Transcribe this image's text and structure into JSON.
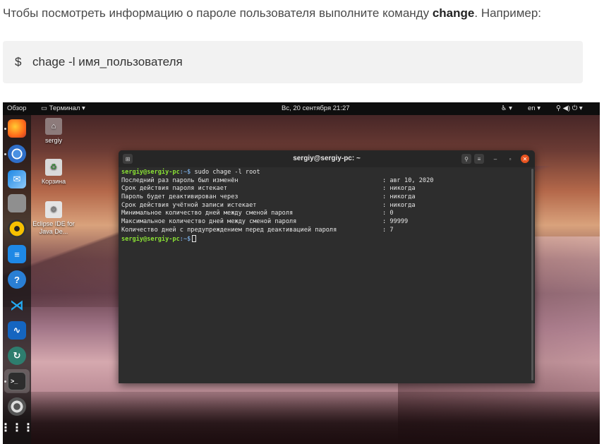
{
  "article": {
    "intro_before": "Чтобы посмотреть информацию о пароле пользователя выполните команду ",
    "intro_bold": "change",
    "intro_after": ". Например:",
    "code_prompt": "$",
    "code_command": "chage -l имя_пользователя"
  },
  "topbar": {
    "activities": "Обзор",
    "app_menu": "Терминал ▾",
    "clock": "Вс, 20 сентября  21:27",
    "accessibility": "♿ ▾",
    "language": "en ▾",
    "system": "⚲ ◀) ⏻ ▾"
  },
  "dock": {
    "icons": [
      "firefox-icon",
      "chromium-icon",
      "thunderbird-icon",
      "files-icon",
      "rhythmbox-icon",
      "writer-icon",
      "help-icon",
      "vscode-icon",
      "system-monitor-icon",
      "update-icon",
      "terminal-icon",
      "settings-icon",
      "apps-grid-icon"
    ]
  },
  "desktop": {
    "items": [
      {
        "label": "sergiy"
      },
      {
        "label": "Корзина"
      },
      {
        "label": "Eclipse IDE for Java De..."
      }
    ]
  },
  "terminal": {
    "title": "sergiy@sergiy-pc: ~",
    "prompt_user": "sergiy@sergiy-pc",
    "prompt_path": ":~$",
    "command": " sudo chage -l root",
    "rows": [
      {
        "key": "Последний раз пароль был изменён",
        "value": ": авг 10, 2020"
      },
      {
        "key": "Срок действия пароля истекает",
        "value": ": никогда"
      },
      {
        "key": "Пароль будет деактивирован через",
        "value": ": никогда"
      },
      {
        "key": "Срок действия учётной записи истекает",
        "value": ": никогда"
      },
      {
        "key": "Минимальное количество дней между сменой пароля",
        "value": ": 0"
      },
      {
        "key": "Максимальное количество дней между сменой пароля",
        "value": ": 99999"
      },
      {
        "key": "Количество дней с предупреждением перед деактивацией пароля",
        "value": ": 7"
      }
    ],
    "prompt2_user": "sergiy@sergiy-pc",
    "prompt2_path": ":~$"
  },
  "colors": {
    "prompt_green": "#8ae234",
    "prompt_blue": "#729fcf",
    "close_orange": "#e95420"
  }
}
